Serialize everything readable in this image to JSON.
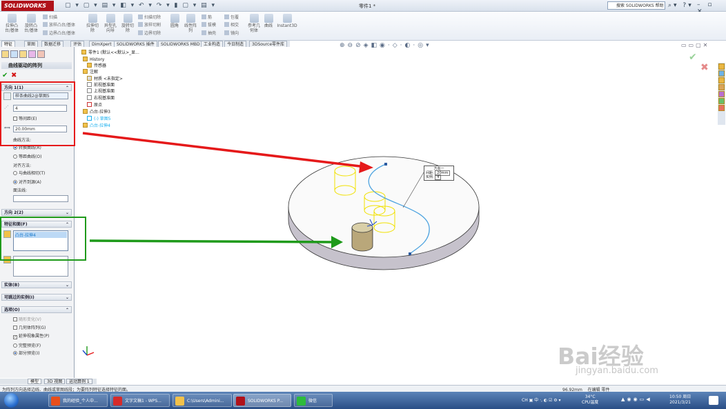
{
  "title_bar": {
    "app_name": "SOLIDWORKS",
    "document_title": "零件1 *",
    "search_placeholder": "搜索 SOLIDWORKS 帮助"
  },
  "ribbon": {
    "big_buttons": [
      {
        "label": "拉伸凸\n台/基体"
      },
      {
        "label": "旋转凸\n台/基体"
      },
      {
        "label": "拉伸切\n除"
      },
      {
        "label": "异型孔\n向导"
      },
      {
        "label": "旋转切\n除"
      },
      {
        "label": "圆角"
      },
      {
        "label": "线性阵\n列"
      },
      {
        "label": "参考几\n何体"
      },
      {
        "label": "曲线"
      },
      {
        "label": "Instant3D"
      }
    ],
    "small_buttons": [
      "扫描",
      "放样凸台/基体",
      "边界凸台/基体",
      "扫描切除",
      "放样切割",
      "边界切除",
      "筋",
      "拔模",
      "抽壳",
      "包覆",
      "相交",
      "镜向"
    ]
  },
  "command_tabs": [
    "特征",
    "草图",
    "数据迁移",
    "评估",
    "DimXpert",
    "SOLIDWORKS 插件",
    "SOLIDWORKS MBD",
    "工业构造",
    "今日制造",
    "3DSource零件库"
  ],
  "property_manager": {
    "title": "曲线驱动的阵列",
    "direction1": {
      "header": "方向 1(1)",
      "curve_field": "样条曲线2@草图5",
      "count_value": "4",
      "equal_spacing_label": "等间距(E)",
      "spacing_value": "20.00mm",
      "curve_method_label": "曲线方法:",
      "method_option1": "转换曲线(R)",
      "method_option2": "等距曲线(O)",
      "alignment_label": "对齐方法:",
      "align_option1": "与曲线相切(T)",
      "align_option2": "对齐到源(A)",
      "face_label": "面法线:"
    },
    "direction2": {
      "header": "方向 2(2)"
    },
    "features": {
      "header": "特征和面(F)",
      "item": "凸台-拉伸4"
    },
    "bodies": {
      "header": "实体(B)"
    },
    "skip": {
      "header": "可跳过的实例(I)"
    },
    "options": {
      "header": "选项(O)",
      "items": [
        {
          "label": "随形变化(V)",
          "checked": false
        },
        {
          "label": "几何体阵列(G)",
          "checked": false
        },
        {
          "label": "延伸视象属性(P)",
          "checked": true
        }
      ],
      "preview_option1": "完整预览(F)",
      "preview_option2": "部分预览(I)"
    }
  },
  "feature_tree": {
    "root": "零件1 (默认<<默认>_显...",
    "items": [
      {
        "label": "History"
      },
      {
        "label": "传感器"
      },
      {
        "label": "注解"
      },
      {
        "label": "材质 <未指定>"
      },
      {
        "label": "前视基准面"
      },
      {
        "label": "上视基准面"
      },
      {
        "label": "右视基准面"
      },
      {
        "label": "原点"
      },
      {
        "label": "凸台-拉伸3"
      },
      {
        "label": "(-) 草图5"
      },
      {
        "label": "凸台-拉伸4"
      }
    ]
  },
  "callout": {
    "title": "方向一",
    "spacing_label": "间距:",
    "spacing_value": "20mm",
    "count_label": "实例:",
    "count_value": "4"
  },
  "bottom_tabs": [
    "模型",
    "3D 视图",
    "运动算例 1"
  ],
  "status_bar": {
    "message": "为阵列方向选择边线、曲线或草图线段；为要阵列特征选择特征的面。",
    "distance": "96.92mm",
    "mode": "在编辑 零件"
  },
  "taskbar": {
    "items": [
      {
        "label": "我的经验_个人中..."
      },
      {
        "label": "文字文稿1 - WPS..."
      },
      {
        "label": "C:\\Users\\Admini..."
      },
      {
        "label": "SOLIDWORKS P..."
      },
      {
        "label": "微信"
      }
    ],
    "weather_temp": "34°C",
    "weather_label": "CPU温度",
    "time": "10:50 周日",
    "date": "2021/3/21"
  },
  "watermark": {
    "brand": "Bai经验",
    "url": "jingyan.baidu.com"
  },
  "colors": {
    "red_highlight": "#e5191a",
    "green_highlight": "#1e9a1a",
    "curve": "#4da3e0",
    "brand": "#b0121a"
  }
}
